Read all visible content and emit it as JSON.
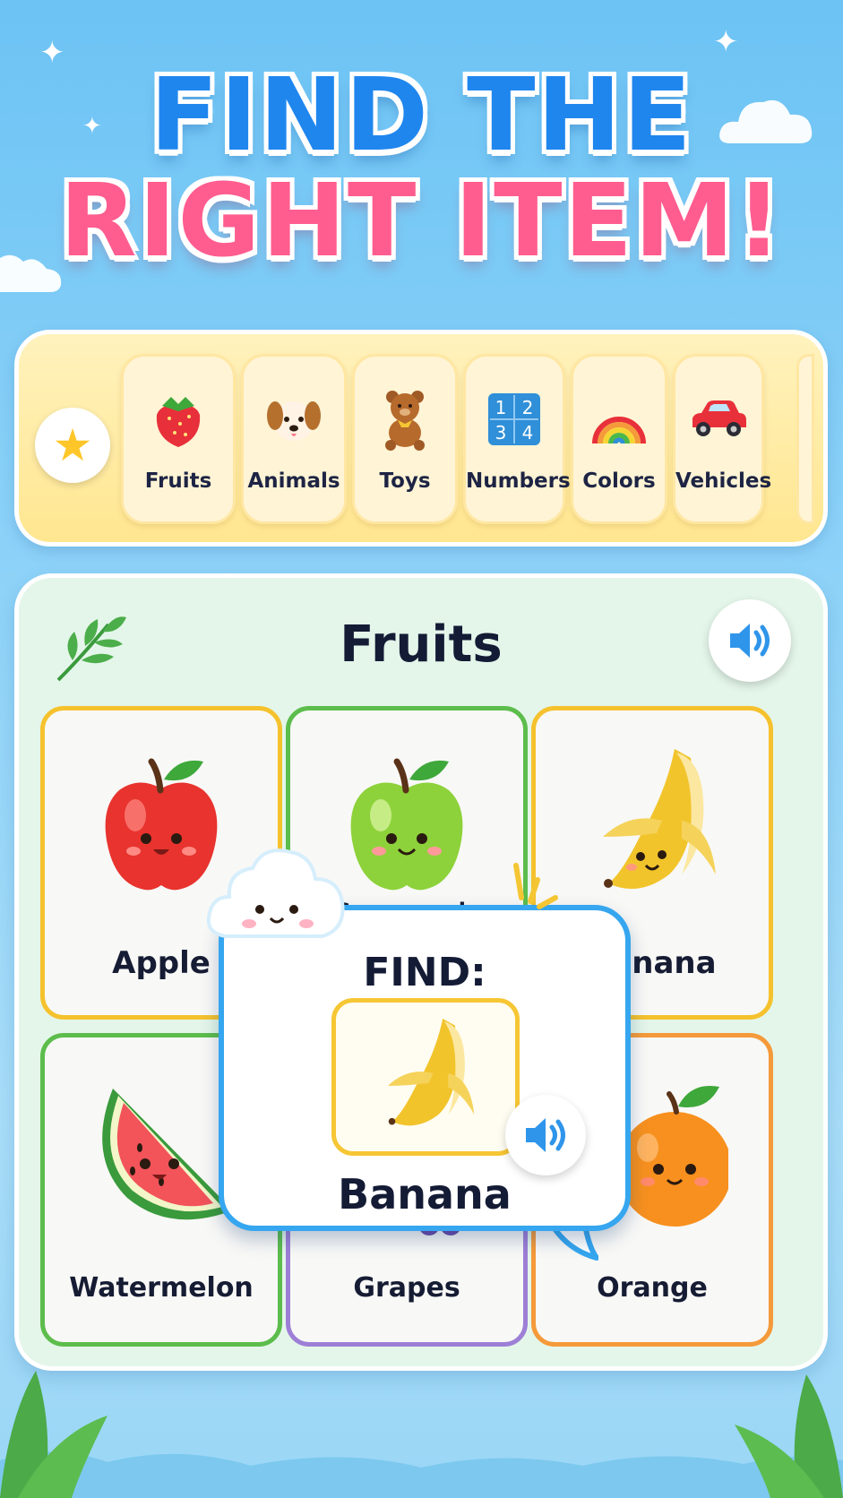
{
  "title": {
    "line1": "FIND THE",
    "line2": "RIGHT ITEM!"
  },
  "categories": [
    {
      "label": "Fruits",
      "icon": "strawberry-icon"
    },
    {
      "label": "Animals",
      "icon": "puppy-icon"
    },
    {
      "label": "Toys",
      "icon": "teddy-bear-icon"
    },
    {
      "label": "Numbers",
      "icon": "number-blocks-icon"
    },
    {
      "label": "Colors",
      "icon": "rainbow-icon"
    },
    {
      "label": "Vehicles",
      "icon": "car-icon"
    }
  ],
  "panel": {
    "title": "Fruits",
    "items": [
      {
        "label": "Apple",
        "border": "#f5c22e"
      },
      {
        "label": "Green apple",
        "border": "#5cbd4c"
      },
      {
        "label": "Banana",
        "border": "#f5c22e"
      },
      {
        "label": "Watermelon",
        "border": "#5cbd4c"
      },
      {
        "label": "Grapes",
        "border": "#9d7fd6"
      },
      {
        "label": "Orange",
        "border": "#f59a3a"
      }
    ]
  },
  "find": {
    "label": "FIND:",
    "target": "Banana"
  },
  "colors": {
    "title_blue": "#1f86ee",
    "title_pink": "#ff5d8f",
    "popup_border": "#35a6ef",
    "sound_blue": "#2f95ea"
  }
}
